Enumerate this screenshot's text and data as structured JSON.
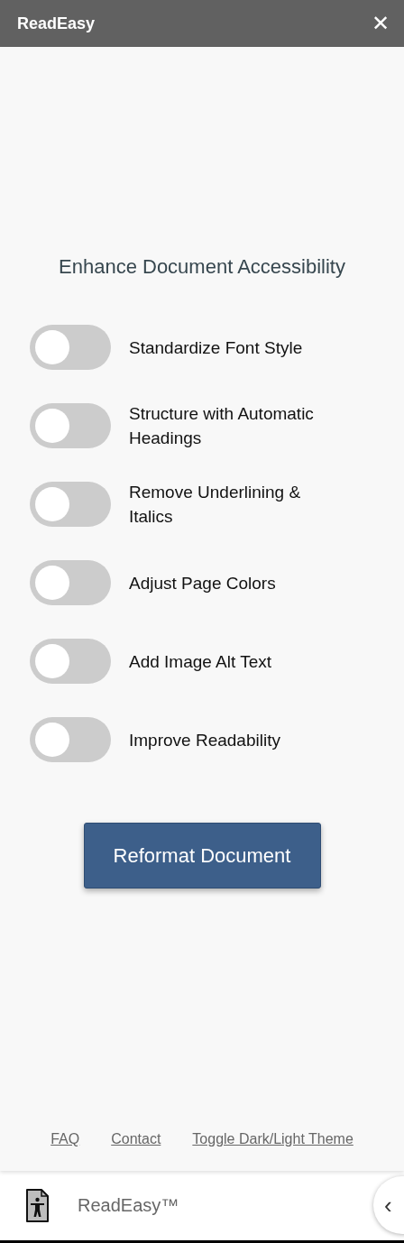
{
  "header": {
    "title": "ReadEasy",
    "close": "✕"
  },
  "heading": "Enhance Document Accessibility",
  "options": [
    {
      "label": "Standardize Font Style",
      "on": false
    },
    {
      "label": "Structure with Automatic Headings",
      "on": false
    },
    {
      "label": "Remove Underlining & Italics",
      "on": false
    },
    {
      "label": "Adjust Page Colors",
      "on": false
    },
    {
      "label": "Add Image Alt Text",
      "on": false
    },
    {
      "label": "Improve Readability",
      "on": false
    }
  ],
  "action_button": "Reformat Document",
  "footer_links": [
    "FAQ",
    "Contact",
    "Toggle Dark/Light Theme"
  ],
  "bottom_bar": {
    "name": "ReadEasy™",
    "collapse": "‹"
  }
}
